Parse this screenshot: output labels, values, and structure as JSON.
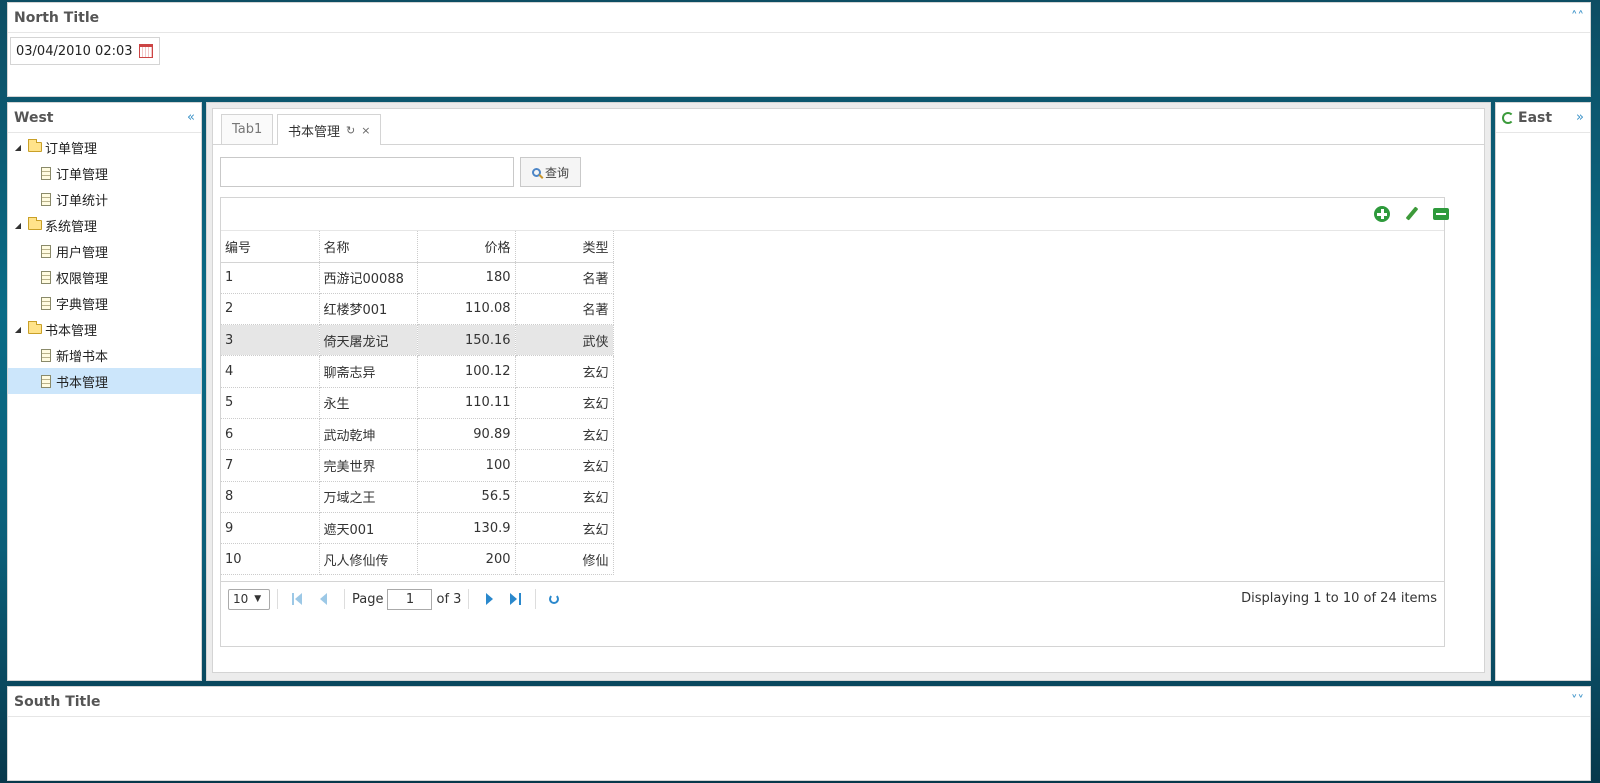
{
  "north": {
    "title": "North Title",
    "datetime": "03/04/2010 02:03"
  },
  "west": {
    "title": "West",
    "tree": [
      {
        "label": "订单管理",
        "children": [
          "订单管理",
          "订单统计"
        ]
      },
      {
        "label": "系统管理",
        "children": [
          "用户管理",
          "权限管理",
          "字典管理"
        ]
      },
      {
        "label": "书本管理",
        "children": [
          "新增书本",
          "书本管理"
        ]
      }
    ],
    "selected": "书本管理"
  },
  "east": {
    "title": "East"
  },
  "south": {
    "title": "South Title"
  },
  "tabs": [
    {
      "label": "Tab1"
    },
    {
      "label": "书本管理"
    }
  ],
  "search": {
    "button_label": "查询",
    "value": ""
  },
  "grid": {
    "columns": [
      "编号",
      "名称",
      "价格",
      "类型"
    ],
    "rows": [
      [
        "1",
        "西游记00088",
        "180",
        "名著"
      ],
      [
        "2",
        "红楼梦001",
        "110.08",
        "名著"
      ],
      [
        "3",
        "倚天屠龙记",
        "150.16",
        "武侠"
      ],
      [
        "4",
        "聊斋志异",
        "100.12",
        "玄幻"
      ],
      [
        "5",
        "永生",
        "110.11",
        "玄幻"
      ],
      [
        "6",
        "武动乾坤",
        "90.89",
        "玄幻"
      ],
      [
        "7",
        "完美世界",
        "100",
        "玄幻"
      ],
      [
        "8",
        "万域之王",
        "56.5",
        "玄幻"
      ],
      [
        "9",
        "遮天001",
        "130.9",
        "玄幻"
      ],
      [
        "10",
        "凡人修仙传",
        "200",
        "修仙"
      ]
    ],
    "highlighted_row": 3
  },
  "pager": {
    "page_size": "10",
    "page_label": "Page",
    "current_page": "1",
    "of_label": "of 3",
    "info": "Displaying 1 to 10 of 24 items"
  },
  "colors": {
    "accent": "#3a92c8",
    "selected": "#cce6fb",
    "highlight_row": "#e6e6e6"
  }
}
